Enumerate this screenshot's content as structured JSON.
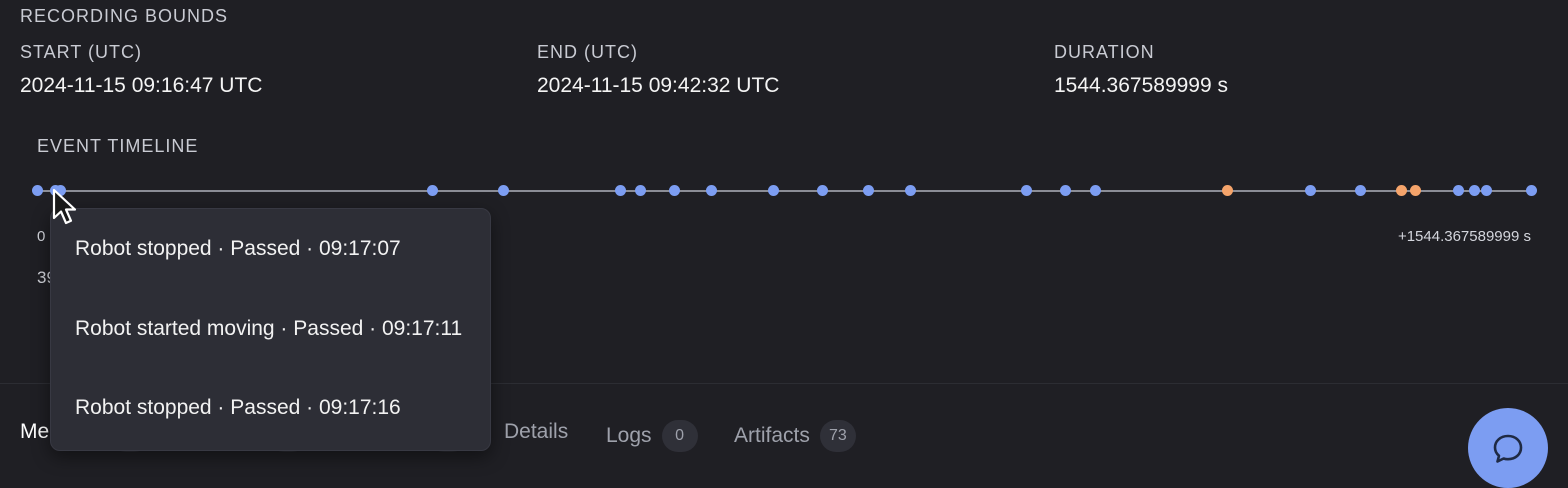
{
  "section_title": "RECORDING BOUNDS",
  "bounds": [
    {
      "label": "START (UTC)",
      "value": "2024-11-15 09:16:47 UTC"
    },
    {
      "label": "END (UTC)",
      "value": "2024-11-15 09:42:32 UTC"
    },
    {
      "label": "DURATION",
      "value": "1544.367589999 s"
    }
  ],
  "timeline": {
    "title": "EVENT TIMELINE",
    "start_label": "0",
    "end_label": "+1544.367589999 s",
    "partial_label": "39",
    "colors": {
      "track": "#8b8d96",
      "passed": "#7c9df2",
      "warning": "#f5a46b"
    },
    "event_offsets_s": [
      0,
      19.4,
      24.2,
      408.5,
      482.1,
      603.5,
      624.2,
      658.6,
      697.5,
      761.7,
      811.9,
      859.4,
      903.0,
      1023.3,
      1063.6,
      1094.1,
      1230.9,
      1316.7,
      1368.1,
      1410.6,
      1425.1,
      1469.7,
      1486.2,
      1498.6,
      1544.4
    ],
    "event_kinds": [
      "passed",
      "passed",
      "passed",
      "passed",
      "passed",
      "passed",
      "passed",
      "passed",
      "passed",
      "passed",
      "passed",
      "passed",
      "passed",
      "passed",
      "passed",
      "passed",
      "warning",
      "passed",
      "passed",
      "warning",
      "warning",
      "passed",
      "passed",
      "passed",
      "passed"
    ]
  },
  "tooltip": {
    "items": [
      "Robot stopped · Passed · 09:17:07",
      "Robot started moving · Passed · 09:17:11",
      "Robot stopped · Passed · 09:17:16"
    ]
  },
  "tabs": [
    {
      "label": "Me",
      "badge": ""
    },
    {
      "label": "Details",
      "badge": ""
    },
    {
      "label": "Logs",
      "badge": "0"
    },
    {
      "label": "Artifacts",
      "badge": "73"
    }
  ],
  "chat": {
    "icon": "chat-bubble-icon"
  }
}
